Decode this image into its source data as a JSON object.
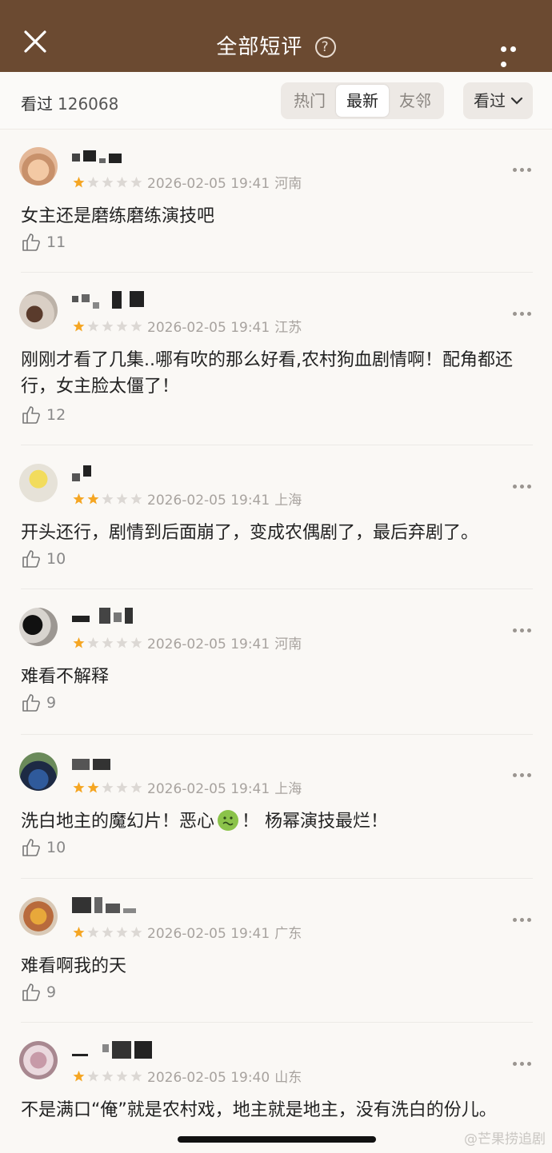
{
  "header": {
    "title": "全部短评",
    "help_glyph": "?"
  },
  "filter": {
    "seen_label": "看过",
    "seen_count": "126068",
    "tabs": [
      "热门",
      "最新",
      "友邻"
    ],
    "active_tab": "最新",
    "dropdown_label": "看过"
  },
  "reviews": [
    {
      "stars": 1,
      "date": "2026-02-05 19:41",
      "location": "河南",
      "text": "女主还是磨练磨练演技吧",
      "likes": "11"
    },
    {
      "stars": 1,
      "date": "2026-02-05 19:41",
      "location": "江苏",
      "text": "刚刚才看了几集..哪有吹的那么好看,农村狗血剧情啊！配角都还行，女主脸太僵了！",
      "likes": "12"
    },
    {
      "stars": 2,
      "date": "2026-02-05 19:41",
      "location": "上海",
      "text": "开头还行，剧情到后面崩了，变成农偶剧了，最后弃剧了。",
      "likes": "10"
    },
    {
      "stars": 1,
      "date": "2026-02-05 19:41",
      "location": "河南",
      "text": "难看不解释",
      "likes": "9"
    },
    {
      "stars": 2,
      "date": "2026-02-05 19:41",
      "location": "上海",
      "text_before": "洗白地主的魔幻片！恶心",
      "text_after": "！ 杨幂演技最烂！",
      "likes": "10"
    },
    {
      "stars": 1,
      "date": "2026-02-05 19:41",
      "location": "广东",
      "text": "难看啊我的天",
      "likes": "9"
    },
    {
      "stars": 1,
      "date": "2026-02-05 19:40",
      "location": "山东",
      "text": "不是满口“俺”就是农村戏，地主就是地主，没有洗白的份儿。",
      "likes": ""
    }
  ],
  "watermark": "@芒果捞追剧",
  "colors": {
    "header_bg": "#6b4a31",
    "star_on": "#f5a623",
    "star_off": "#dcd8d4"
  }
}
